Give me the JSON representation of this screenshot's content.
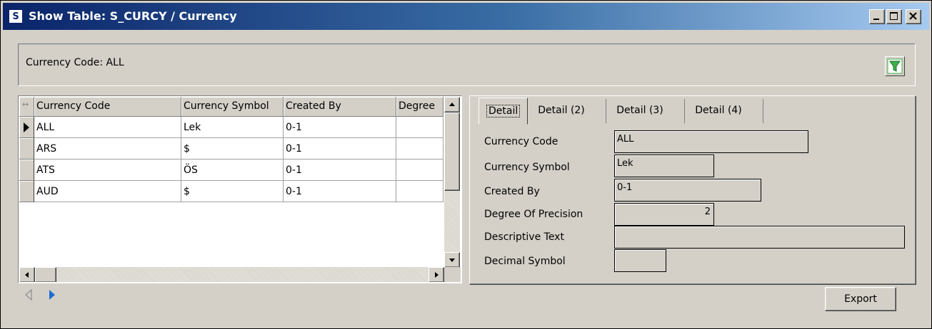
{
  "window": {
    "app_icon_letter": "S",
    "title": "Show Table: S_CURCY / Currency"
  },
  "filter": {
    "label": "Currency Code: ALL"
  },
  "grid": {
    "columns": [
      "Currency Code",
      "Currency Symbol",
      "Created By",
      "Degree"
    ],
    "rows": [
      {
        "code": "ALL",
        "symbol": "Lek",
        "created_by": "0-1",
        "degree": ""
      },
      {
        "code": "ARS",
        "symbol": "$",
        "created_by": "0-1",
        "degree": ""
      },
      {
        "code": "ATS",
        "symbol": "ÖS",
        "created_by": "0-1",
        "degree": ""
      },
      {
        "code": "AUD",
        "symbol": "$",
        "created_by": "0-1",
        "degree": ""
      }
    ]
  },
  "tabs": [
    "Detail",
    "Detail (2)",
    "Detail (3)",
    "Detail (4)"
  ],
  "detail": {
    "fields": [
      {
        "label": "Currency Code",
        "value": "ALL"
      },
      {
        "label": "Currency Symbol",
        "value": "Lek"
      },
      {
        "label": "Created By",
        "value": "0-1"
      },
      {
        "label": "Degree Of Precision",
        "value": "2"
      },
      {
        "label": "Descriptive Text",
        "value": ""
      },
      {
        "label": "Decimal Symbol",
        "value": ""
      }
    ]
  },
  "buttons": {
    "export": "Export"
  },
  "icons": {
    "filter": "filter-icon",
    "prev": "nav-prev-icon",
    "next": "nav-next-icon"
  },
  "colors": {
    "titlebar_start": "#0a246a",
    "titlebar_end": "#a6caf0",
    "face": "#d4d0c8",
    "filter_icon": "#3ab34a",
    "nav_next": "#1a6fd1"
  }
}
